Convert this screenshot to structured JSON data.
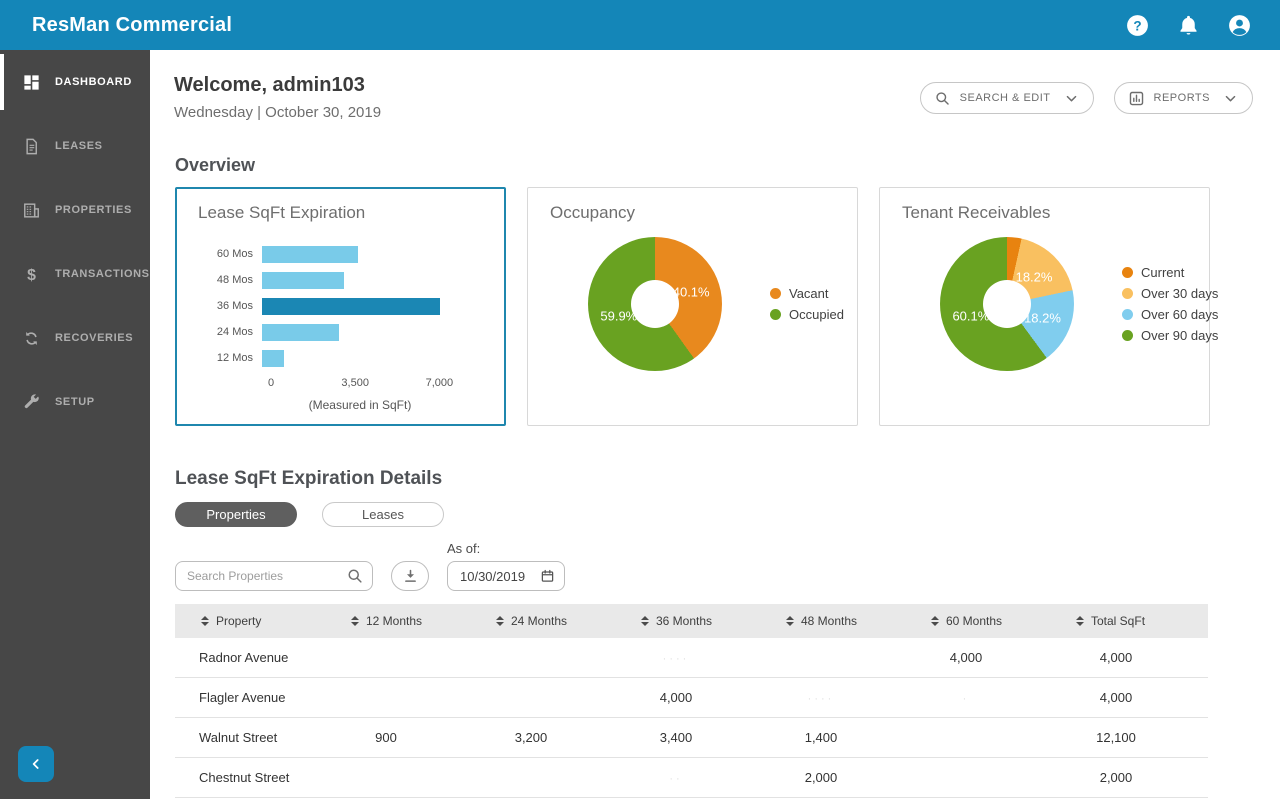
{
  "topbar": {
    "brand": "ResMan Commercial",
    "icons": [
      "help-icon",
      "notifications-icon",
      "account-icon"
    ]
  },
  "sidebar": {
    "items": [
      {
        "label": "DASHBOARD",
        "icon": "dashboard-icon",
        "active": true
      },
      {
        "label": "LEASES",
        "icon": "leases-icon",
        "active": false
      },
      {
        "label": "PROPERTIES",
        "icon": "properties-icon",
        "active": false
      },
      {
        "label": "TRANSACTIONS",
        "icon": "transactions-icon",
        "active": false
      },
      {
        "label": "RECOVERIES",
        "icon": "recoveries-icon",
        "active": false
      },
      {
        "label": "SETUP",
        "icon": "setup-icon",
        "active": false
      }
    ]
  },
  "header": {
    "welcome": "Welcome, admin103",
    "date": "Wednesday | October 30, 2019",
    "search_edit_label": "SEARCH & EDIT",
    "reports_label": "REPORTS"
  },
  "overview": {
    "title": "Overview"
  },
  "chart_data": [
    {
      "type": "bar",
      "orientation": "horizontal",
      "title": "Lease SqFt Expiration",
      "categories": [
        "60 Mos",
        "48 Mos",
        "36 Mos",
        "24 Mos",
        "12 Mos"
      ],
      "values": [
        4000,
        3400,
        7400,
        3200,
        900
      ],
      "xlabel": "(Measured in SqFt)",
      "xlim": [
        0,
        7400
      ],
      "xticks": [
        0,
        3500,
        7000
      ],
      "xtick_labels": [
        "0",
        "3,500",
        "7,000"
      ],
      "bar_color": "#79cbe9",
      "highlight_index": 2,
      "highlight_color": "#1b87b4",
      "selected_card": true
    },
    {
      "type": "pie",
      "donut": true,
      "title": "Occupancy",
      "legend_position": "right",
      "slices": [
        {
          "label": "Vacant",
          "value": 40.1,
          "display": "40.1%",
          "color": "#e8891e"
        },
        {
          "label": "Occupied",
          "value": 59.9,
          "display": "59.9%",
          "color": "#69a221"
        }
      ]
    },
    {
      "type": "pie",
      "donut": true,
      "title": "Tenant Receivables",
      "legend_position": "right",
      "slices": [
        {
          "label": "Current",
          "value": 3.5,
          "display": "",
          "color": "#e8830f"
        },
        {
          "label": "Over 30 days",
          "value": 18.2,
          "display": "18.2%",
          "color": "#f9c060"
        },
        {
          "label": "Over 60 days",
          "value": 18.2,
          "display": "18.2%",
          "color": "#80cdee"
        },
        {
          "label": "Over 90 days",
          "value": 60.1,
          "display": "60.1%",
          "color": "#69a221"
        }
      ]
    }
  ],
  "details": {
    "title": "Lease SqFt Expiration Details",
    "tabs": [
      {
        "label": "Properties",
        "active": true
      },
      {
        "label": "Leases",
        "active": false
      }
    ],
    "search_placeholder": "Search Properties",
    "as_of_label": "As of:",
    "date_value": "10/30/2019"
  },
  "table": {
    "headers": [
      "Property",
      "12 Months",
      "24 Months",
      "36 Months",
      "48 Months",
      "60 Months",
      "Total SqFt"
    ],
    "rows": [
      {
        "property": "Radnor Avenue",
        "m12": "",
        "m24": "",
        "m36": "",
        "m36_faint": "····",
        "m48": "",
        "m60": "4,000",
        "total": "4,000"
      },
      {
        "property": "Flagler Avenue",
        "m12": "",
        "m24": "",
        "m36": "4,000",
        "m48": "",
        "m48_faint": "····",
        "m60": "",
        "m60_faint": "·",
        "total": "4,000"
      },
      {
        "property": "Walnut Street",
        "m12": "900",
        "m24": "3,200",
        "m36": "3,400",
        "m48": "1,400",
        "m60": "",
        "total": "12,100"
      },
      {
        "property": "Chestnut Street",
        "m12": "",
        "m24": "",
        "m36": "",
        "m36_faint": "··",
        "m48": "2,000",
        "m60": "",
        "total": "2,000"
      }
    ]
  },
  "colors": {
    "topbar": "#1486b8",
    "sidebar": "#474747",
    "selected_card_border": "#1f87ae",
    "bar_light": "#79cbe9",
    "bar_dark": "#1b87b4",
    "orange": "#e8891e",
    "green": "#69a221",
    "amber": "#f9c060",
    "light_blue": "#80cdee"
  }
}
